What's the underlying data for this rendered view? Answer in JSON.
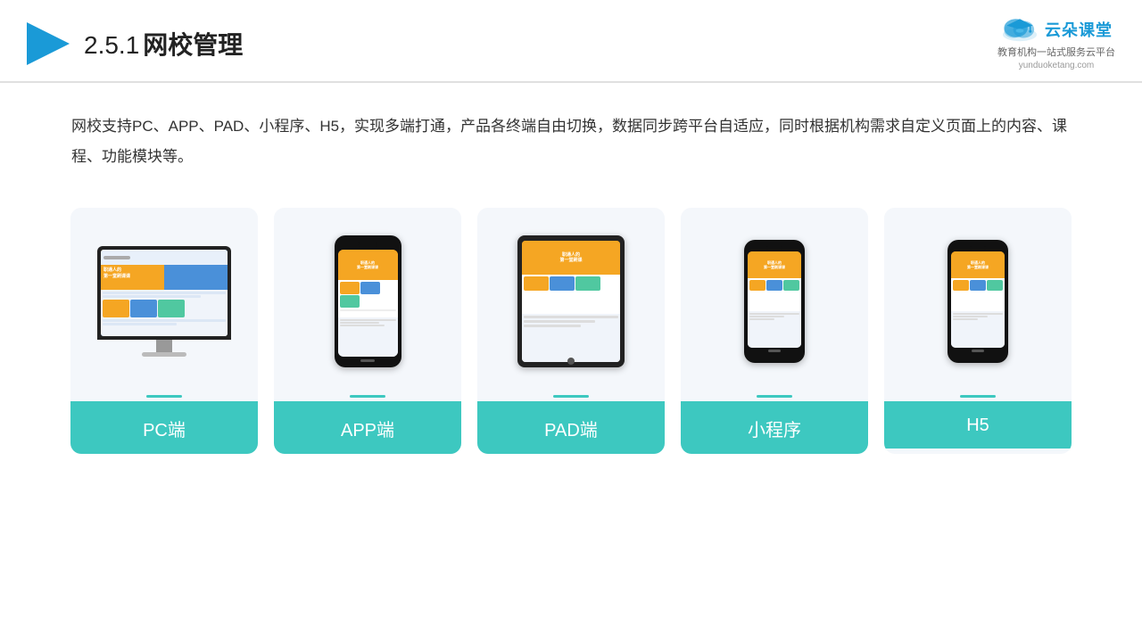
{
  "header": {
    "title": "网校管理",
    "number": "2.5.1",
    "logo_main": "云朵课堂",
    "logo_url": "yunduoketang.com",
    "logo_tagline1": "教育机构一站",
    "logo_tagline2": "式服务云平台"
  },
  "description": {
    "text": "网校支持PC、APP、PAD、小程序、H5，实现多端打通，产品各终端自由切换，数据同步跨平台自适应，同时根据机构需求自定义页面上的内容、课程、功能模块等。"
  },
  "cards": [
    {
      "id": "pc",
      "label": "PC端"
    },
    {
      "id": "app",
      "label": "APP端"
    },
    {
      "id": "pad",
      "label": "PAD端"
    },
    {
      "id": "miniprogram",
      "label": "小程序"
    },
    {
      "id": "h5",
      "label": "H5"
    }
  ],
  "accent_color": "#3dc8c0"
}
